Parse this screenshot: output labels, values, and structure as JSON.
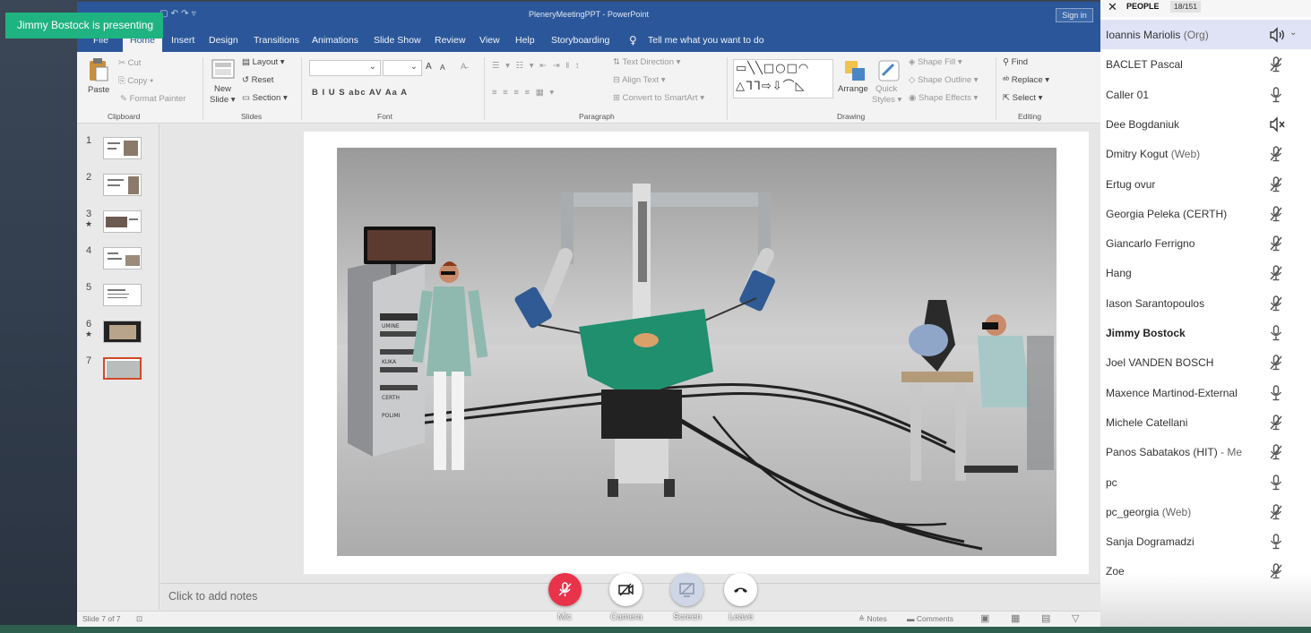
{
  "presenter_badge": "Jimmy Bostock is presenting",
  "ppt": {
    "title": "PleneryMeetingPPT  -  PowerPoint",
    "sign_in": "Sign in",
    "tabs": [
      {
        "label": "File"
      },
      {
        "label": "Home"
      },
      {
        "label": "Insert"
      },
      {
        "label": "Design"
      },
      {
        "label": "Transitions"
      },
      {
        "label": "Animations"
      },
      {
        "label": "Slide Show"
      },
      {
        "label": "Review"
      },
      {
        "label": "View"
      },
      {
        "label": "Help"
      },
      {
        "label": "Storyboarding"
      }
    ],
    "tell_me": "Tell me what you want to do",
    "ribbon": {
      "clipboard": {
        "label": "Clipboard",
        "paste": "Paste",
        "cut": "Cut",
        "copy": "Copy",
        "format_painter": "Format Painter"
      },
      "slides": {
        "label": "Slides",
        "new_slide": "New",
        "new_slide2": "Slide",
        "layout": "Layout",
        "reset": "Reset",
        "section": "Section"
      },
      "font": {
        "label": "Font",
        "font_size_up": "A",
        "font_size_down": "A",
        "format_row": "B   I   U   S   abc   AV   Aa   A"
      },
      "paragraph": {
        "label": "Paragraph",
        "text_direction": "Text Direction",
        "align_text": "Align Text",
        "convert_smartart": "Convert to SmartArt"
      },
      "drawing": {
        "label": "Drawing",
        "arrange": "Arrange",
        "quick_styles": "Quick",
        "quick_styles2": "Styles",
        "shape_fill": "Shape Fill",
        "shape_outline": "Shape Outline",
        "shape_effects": "Shape Effects"
      },
      "editing": {
        "label": "Editing",
        "find": "Find",
        "replace": "Replace",
        "select": "Select"
      }
    },
    "slides": [
      {
        "num": "1",
        "star": ""
      },
      {
        "num": "2",
        "star": ""
      },
      {
        "num": "3",
        "star": "★"
      },
      {
        "num": "4",
        "star": ""
      },
      {
        "num": "5",
        "star": ""
      },
      {
        "num": "6",
        "star": "★"
      },
      {
        "num": "7",
        "star": ""
      }
    ],
    "slide_labels": {
      "cabinet_1": "UMINE",
      "cabinet_2": "KUKA",
      "cabinet_3": "CERTH",
      "cabinet_4": "POLIMI"
    },
    "notes_placeholder": "Click to add notes",
    "status": {
      "slide_of": "Slide 7 of 7",
      "notes": "Notes",
      "comments": "Comments"
    }
  },
  "call_controls": [
    {
      "label": "Mic"
    },
    {
      "label": "Camera"
    },
    {
      "label": "Screen"
    },
    {
      "label": "Leave"
    }
  ],
  "people": {
    "title": "PEOPLE",
    "count": "18/151",
    "list": [
      {
        "name": "Ioannis Mariolis",
        "tag": "(Org)",
        "status_icon": "speaker-active-icon"
      },
      {
        "name": "BACLET Pascal",
        "tag": "",
        "status_icon": "mic-muted-icon"
      },
      {
        "name": "Caller 01",
        "tag": "",
        "status_icon": "mic-icon"
      },
      {
        "name": "Dee Bogdaniuk",
        "tag": "",
        "status_icon": "speaker-muted-icon"
      },
      {
        "name": "Dmitry Kogut",
        "tag": "(Web)",
        "status_icon": "mic-muted-icon"
      },
      {
        "name": "Ertug ovur",
        "tag": "",
        "status_icon": "mic-muted-icon"
      },
      {
        "name": "Georgia Peleka (CERTH)",
        "tag": "",
        "status_icon": "mic-muted-icon"
      },
      {
        "name": "Giancarlo Ferrigno",
        "tag": "",
        "status_icon": "mic-muted-icon"
      },
      {
        "name": "Hang",
        "tag": "",
        "status_icon": "mic-muted-icon"
      },
      {
        "name": "Iason Sarantopoulos",
        "tag": "",
        "status_icon": "mic-muted-icon"
      },
      {
        "name": "Jimmy Bostock",
        "tag": "",
        "status_icon": "mic-icon"
      },
      {
        "name": "Joel VANDEN BOSCH",
        "tag": "",
        "status_icon": "mic-muted-icon"
      },
      {
        "name": "Maxence Martinod-External",
        "tag": "",
        "status_icon": "mic-icon"
      },
      {
        "name": "Michele Catellani",
        "tag": "",
        "status_icon": "mic-muted-icon"
      },
      {
        "name": "Panos Sabatakos (HIT)",
        "tag": "- Me",
        "status_icon": "mic-muted-icon"
      },
      {
        "name": "pc",
        "tag": "",
        "status_icon": "mic-icon"
      },
      {
        "name": "pc_georgia",
        "tag": "(Web)",
        "status_icon": "mic-muted-icon"
      },
      {
        "name": "Sanja Dogramadzi",
        "tag": "",
        "status_icon": "mic-icon"
      },
      {
        "name": "Zoe",
        "tag": "",
        "status_icon": "mic-muted-icon"
      }
    ]
  },
  "colors": {
    "accent_green": "#1fb381",
    "ppt_blue": "#2b579a",
    "leave_red": "#e8334a",
    "selected_thumb": "#d24726"
  }
}
